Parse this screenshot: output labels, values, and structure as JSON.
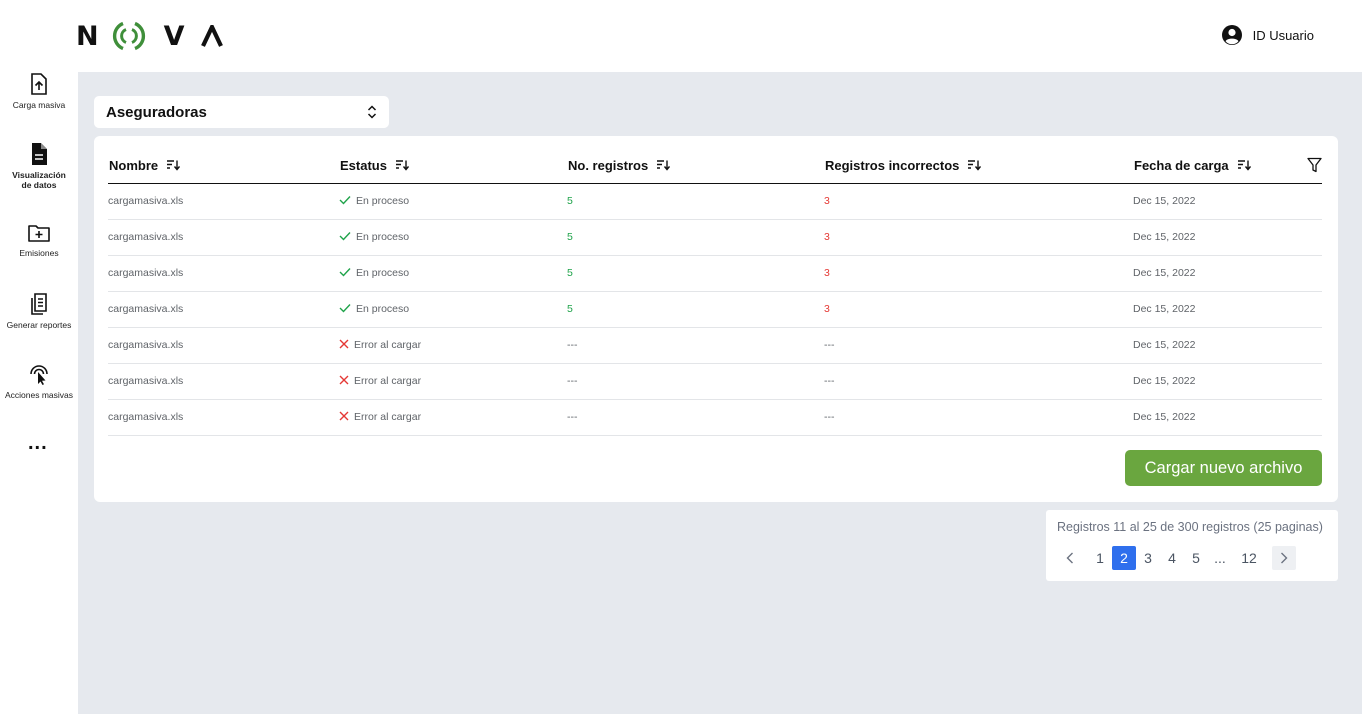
{
  "header": {
    "logo_letters": [
      "N",
      "V"
    ],
    "user_label": "ID Usuario"
  },
  "sidebar": {
    "items": [
      {
        "label": "Carga masiva",
        "icon": "upload-file-icon"
      },
      {
        "label": "Visualización de datos",
        "icon": "document-icon"
      },
      {
        "label": "Emisiones",
        "icon": "add-folder-icon"
      },
      {
        "label": "Generar reportes",
        "icon": "reports-icon"
      },
      {
        "label": "Acciones masivas",
        "icon": "tap-cursor-icon"
      }
    ],
    "more": "..."
  },
  "selector": {
    "value": "Aseguradoras"
  },
  "table": {
    "columns": [
      "Nombre",
      "Estatus",
      "No. registros",
      "Registros incorrectos",
      "Fecha de carga"
    ],
    "rows": [
      {
        "name": "cargamasiva.xls",
        "status": "En proceso",
        "ok": true,
        "records": "5",
        "incorrect": "3",
        "date": "Dec 15, 2022"
      },
      {
        "name": "cargamasiva.xls",
        "status": "En proceso",
        "ok": true,
        "records": "5",
        "incorrect": "3",
        "date": "Dec 15, 2022"
      },
      {
        "name": "cargamasiva.xls",
        "status": "En proceso",
        "ok": true,
        "records": "5",
        "incorrect": "3",
        "date": "Dec 15, 2022"
      },
      {
        "name": "cargamasiva.xls",
        "status": "En proceso",
        "ok": true,
        "records": "5",
        "incorrect": "3",
        "date": "Dec 15, 2022"
      },
      {
        "name": "cargamasiva.xls",
        "status": "Error al cargar",
        "ok": false,
        "records": "---",
        "incorrect": "---",
        "date": "Dec 15, 2022"
      },
      {
        "name": "cargamasiva.xls",
        "status": "Error al cargar",
        "ok": false,
        "records": "---",
        "incorrect": "---",
        "date": "Dec 15, 2022"
      },
      {
        "name": "cargamasiva.xls",
        "status": "Error al cargar",
        "ok": false,
        "records": "---",
        "incorrect": "---",
        "date": "Dec 15, 2022"
      }
    ]
  },
  "upload_button": "Cargar nuevo archivo",
  "pagination": {
    "info": "Registros 11 al 25 de 300 registros (25 paginas)",
    "pages": [
      "1",
      "2",
      "3",
      "4",
      "5",
      "...",
      "12"
    ],
    "current": "2"
  },
  "colors": {
    "accent_green": "#6aa63f",
    "logo_green": "#3f8f3a",
    "active_page": "#2f6fed",
    "status_ok": "#1fa34a",
    "status_error": "#e53935",
    "background": "#e6e9ee"
  }
}
